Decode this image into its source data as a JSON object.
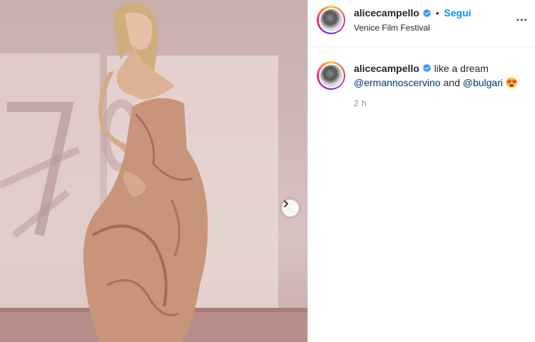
{
  "post": {
    "username": "alicecampello",
    "location": "Venice Film Festival",
    "follow_label": "Segui",
    "dot": "•",
    "more_label": "..."
  },
  "caption": {
    "username": "alicecampello",
    "text": "like a dream",
    "mention1": "@ermannoscervino",
    "conjunction": "and",
    "mention2": "@bulgari",
    "emoji": "😍",
    "time": "2 h"
  },
  "colors": {
    "verified": "#3897f0",
    "link": "#0095f6",
    "mention": "#00376b"
  },
  "icons": {
    "carousel_next": "chevron-right-icon",
    "verified": "verified-badge-icon"
  }
}
